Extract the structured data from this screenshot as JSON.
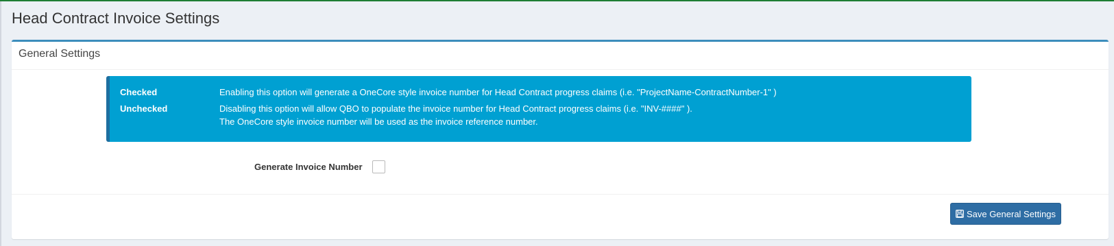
{
  "page": {
    "title": "Head Contract Invoice Settings"
  },
  "general_settings": {
    "title": "General Settings",
    "callout": {
      "checked_label": "Checked",
      "checked_text": "Enabling this option will generate a OneCore style invoice number for Head Contract progress claims (i.e. \"ProjectName-ContractNumber-1\" )",
      "unchecked_label": "Unchecked",
      "unchecked_text_1": "Disabling this option will allow QBO to populate the invoice number for Head Contract progress claims (i.e. \"INV-####\" ).",
      "unchecked_text_2": "The OneCore style invoice number will be used as the invoice reference number."
    },
    "field": {
      "label": "Generate Invoice Number",
      "checked": false
    },
    "save_button": {
      "label": "Save General Settings",
      "icon": "floppy-disk-icon"
    }
  },
  "colors": {
    "accent": "#3c8dbc",
    "callout_bg": "#00a0d2",
    "button_bg": "#2e6da4",
    "background": "#ecf0f5"
  }
}
